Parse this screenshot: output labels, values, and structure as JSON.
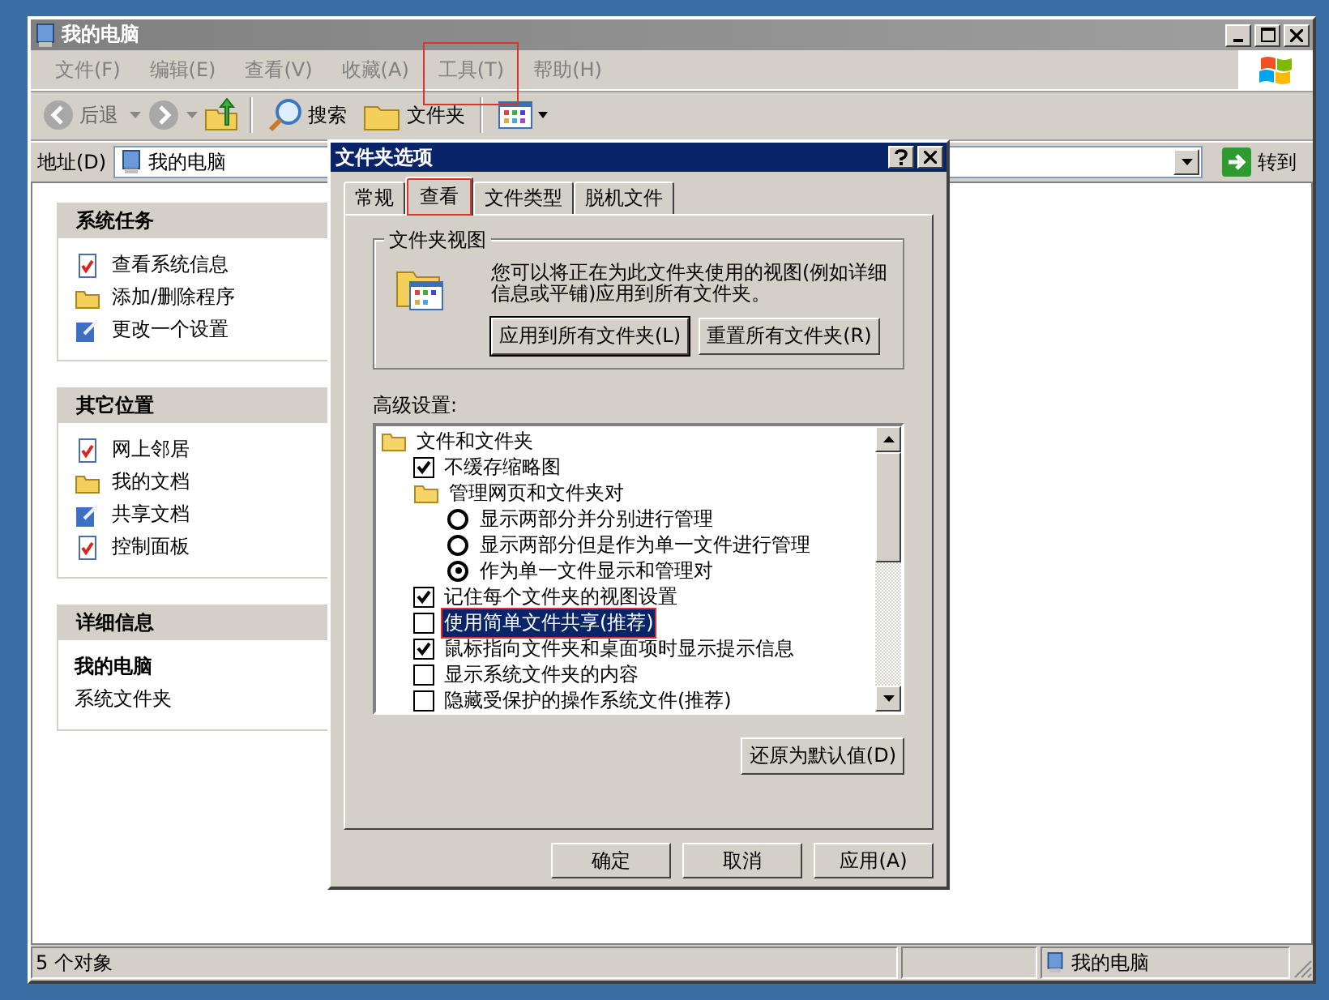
{
  "window": {
    "title": "我的电脑"
  },
  "menu": [
    {
      "label": "文件(F)",
      "highlighted": false
    },
    {
      "label": "编辑(E)",
      "highlighted": false
    },
    {
      "label": "查看(V)",
      "highlighted": false
    },
    {
      "label": "收藏(A)",
      "highlighted": false
    },
    {
      "label": "工具(T)",
      "highlighted": true
    },
    {
      "label": "帮助(H)",
      "highlighted": false
    }
  ],
  "toolbar": {
    "back": "后退",
    "search": "搜索",
    "folders": "文件夹"
  },
  "address": {
    "label": "地址(D)",
    "value": "我的电脑",
    "go": "转到"
  },
  "sidebar": [
    {
      "kind": "links",
      "title": "系统任务",
      "items": [
        "查看系统信息",
        "添加/删除程序",
        "更改一个设置"
      ]
    },
    {
      "kind": "links",
      "title": "其它位置",
      "items": [
        "网上邻居",
        "我的文档",
        "共享文档",
        "控制面板"
      ]
    },
    {
      "kind": "details",
      "title": "详细信息",
      "name": "我的电脑",
      "subtitle": "系统文件夹"
    }
  ],
  "dialog": {
    "title": "文件夹选项",
    "tabs": [
      {
        "label": "常规",
        "selected": false,
        "highlighted": false
      },
      {
        "label": "查看",
        "selected": true,
        "highlighted": true
      },
      {
        "label": "文件类型",
        "selected": false,
        "highlighted": false
      },
      {
        "label": "脱机文件",
        "selected": false,
        "highlighted": false
      }
    ],
    "folder_views": {
      "legend": "文件夹视图",
      "text": "您可以将正在为此文件夹使用的视图(例如详细信息或平铺)应用到所有文件夹。",
      "buttons": [
        "应用到所有文件夹(L)",
        "重置所有文件夹(R)"
      ]
    },
    "advanced": {
      "label": "高级设置:",
      "items": [
        {
          "kind": "folder",
          "label": "文件和文件夹",
          "children": [
            {
              "kind": "checkbox",
              "label": "不缓存缩略图",
              "checked": true,
              "selected": false,
              "highlighted": false
            },
            {
              "kind": "folder",
              "label": "管理网页和文件夹对",
              "children": [
                {
                  "kind": "radio",
                  "label": "显示两部分并分别进行管理",
                  "checked": false,
                  "selected": false,
                  "highlighted": false
                },
                {
                  "kind": "radio",
                  "label": "显示两部分但是作为单一文件进行管理",
                  "checked": false,
                  "selected": false,
                  "highlighted": false
                },
                {
                  "kind": "radio",
                  "label": "作为单一文件显示和管理对",
                  "checked": true,
                  "selected": false,
                  "highlighted": false
                }
              ]
            },
            {
              "kind": "checkbox",
              "label": "记住每个文件夹的视图设置",
              "checked": true,
              "selected": false,
              "highlighted": false
            },
            {
              "kind": "checkbox",
              "label": "使用简单文件共享(推荐)",
              "checked": false,
              "selected": true,
              "highlighted": true
            },
            {
              "kind": "checkbox",
              "label": "鼠标指向文件夹和桌面项时显示提示信息",
              "checked": true,
              "selected": false,
              "highlighted": false
            },
            {
              "kind": "checkbox",
              "label": "显示系统文件夹的内容",
              "checked": false,
              "selected": false,
              "highlighted": false
            },
            {
              "kind": "checkbox",
              "label": "隐藏受保护的操作系统文件(推荐)",
              "checked": false,
              "selected": false,
              "highlighted": false
            }
          ]
        }
      ]
    },
    "restore_button": "还原为默认值(D)",
    "buttons": [
      "确定",
      "取消",
      "应用(A)"
    ]
  },
  "status_bar": {
    "text": "5 个对象",
    "location": "我的电脑"
  }
}
